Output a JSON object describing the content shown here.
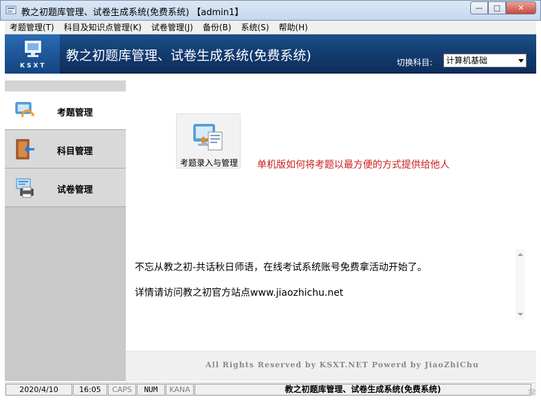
{
  "window": {
    "title": "教之初题库管理、试卷生成系统(免费系统) 【admin1】",
    "min_icon": "minimize-icon",
    "max_icon": "maximize-icon",
    "close_icon": "close-icon"
  },
  "menu": {
    "items": [
      {
        "label": "考题管理(T)"
      },
      {
        "label": "科目及知识点管理(K)"
      },
      {
        "label": "试卷管理(J)"
      },
      {
        "label": "备份(B)"
      },
      {
        "label": "系统(S)"
      },
      {
        "label": "帮助(H)"
      }
    ]
  },
  "banner": {
    "logo_text": "KSXT",
    "title": "教之初题库管理、试卷生成系统(免费系统)",
    "subject_label": "切换科目:",
    "subject_value": "计算机基础"
  },
  "sidebar": {
    "items": [
      {
        "label": "考题管理",
        "icon": "exam-refresh-icon",
        "active": true
      },
      {
        "label": "科目管理",
        "icon": "book-arrow-icon",
        "active": false
      },
      {
        "label": "试卷管理",
        "icon": "printer-icon",
        "active": false
      }
    ]
  },
  "main": {
    "tile_label": "考题录入与管理",
    "tile_icon": "exam-entry-icon",
    "help_link": "单机版如何将考题以最方便的方式提供给他人",
    "notice_line1": "不忘从教之初-共话秋日师语，在线考试系统账号免费拿活动开始了。",
    "notice_line2": "详情请访问教之初官方站点www.jiaozhichu.net",
    "copyright": "All Rights Reserved by KSXT.NET Powerd by JiaoZhiChu"
  },
  "status": {
    "date": "2020/4/10",
    "time": "16:05",
    "caps": "CAPS",
    "num": "NUM",
    "kana": "KANA",
    "app_name": "教之初题库管理、试卷生成系统(免费系统)"
  },
  "colors": {
    "banner": "#123a6e",
    "help_link": "#cc1d1d",
    "sidebar": "#c9c9c9"
  }
}
